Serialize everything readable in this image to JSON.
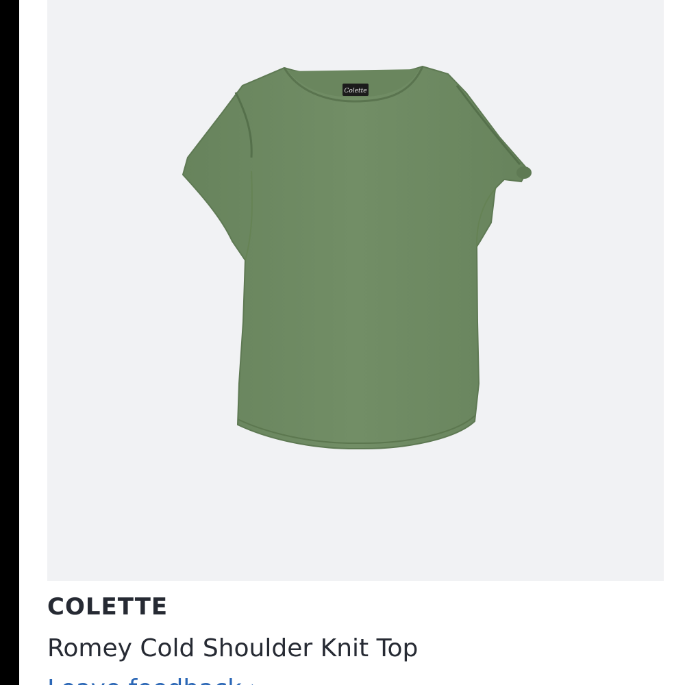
{
  "product": {
    "brand": "COLETTE",
    "name": "Romey Cold Shoulder Knit Top",
    "feedback_link": "Leave feedback ›",
    "image_label": "Colette",
    "image_background": "#f1f2f4",
    "garment_color": "#6f8b63"
  },
  "colors": {
    "text": "#262a33",
    "link": "#2b67b6",
    "left_bar": "#000000"
  }
}
